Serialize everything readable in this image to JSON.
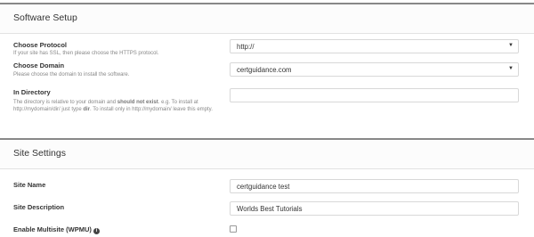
{
  "software_setup": {
    "title": "Software Setup",
    "protocol": {
      "label": "Choose Protocol",
      "help": "If your site has SSL, then please choose the HTTPS protocol.",
      "value": "http://"
    },
    "domain": {
      "label": "Choose Domain",
      "help": "Please choose the domain to install the software.",
      "value": "certguidance.com"
    },
    "directory": {
      "label": "In Directory",
      "help_part1": "The directory is relative to your domain and ",
      "help_bold1": "should not exist",
      "help_part2": ". e.g. To install at http://mydomain/dir/ just type ",
      "help_bold2": "dir",
      "help_part3": ". To install only in http://mydomain/ leave this empty.",
      "value": ""
    }
  },
  "site_settings": {
    "title": "Site Settings",
    "site_name": {
      "label": "Site Name",
      "value": "certguidance test"
    },
    "site_description": {
      "label": "Site Description",
      "value": "Worlds Best Tutorials"
    },
    "multisite": {
      "label": "Enable Multisite (WPMU)",
      "checked": false
    }
  },
  "icons": {
    "caret": "caret-down-icon",
    "info": "info-icon"
  }
}
